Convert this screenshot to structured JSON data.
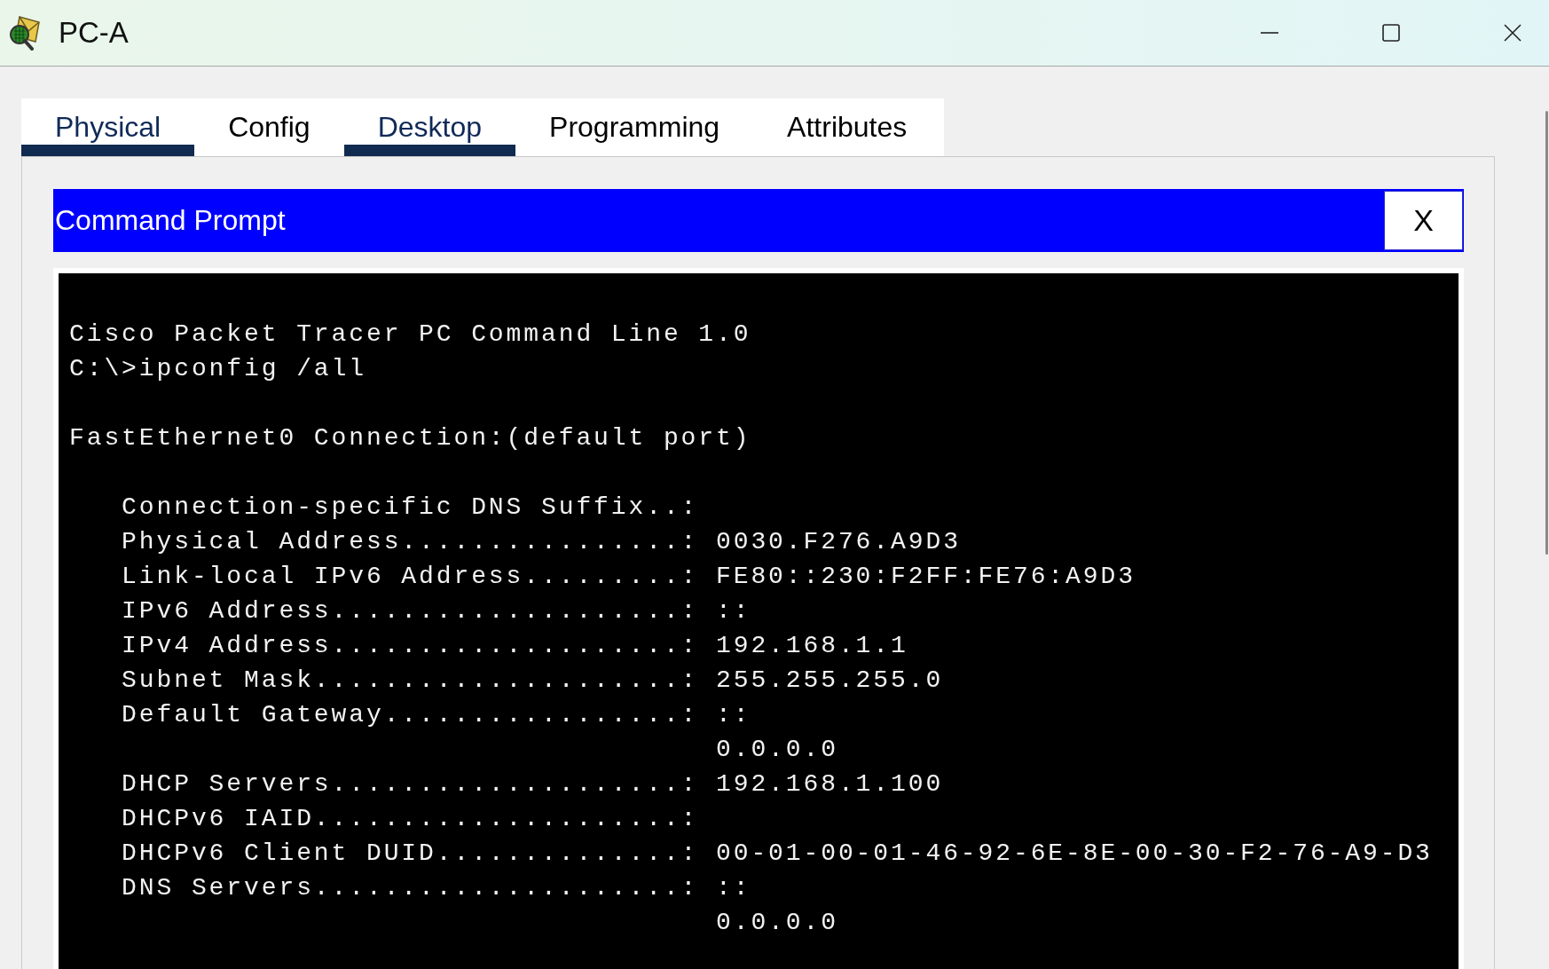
{
  "window": {
    "title": "PC-A"
  },
  "tabs": [
    {
      "label": "Physical",
      "selected": true
    },
    {
      "label": "Config",
      "selected": false
    },
    {
      "label": "Desktop",
      "selected": true
    },
    {
      "label": "Programming",
      "selected": false
    },
    {
      "label": "Attributes",
      "selected": false
    }
  ],
  "command_prompt": {
    "title": "Command Prompt",
    "close_label": "X",
    "blocks": [
      {
        "lines": [
          "Cisco Packet Tracer PC Command Line 1.0",
          "C:\\>ipconfig /all"
        ]
      },
      {
        "lines": [
          "FastEthernet0 Connection:(default port)"
        ]
      },
      {
        "lines": [
          "   Connection-specific DNS Suffix..:",
          "   Physical Address................: 0030.F276.A9D3",
          "   Link-local IPv6 Address.........: FE80::230:F2FF:FE76:A9D3",
          "   IPv6 Address....................: ::",
          "   IPv4 Address....................: 192.168.1.1",
          "   Subnet Mask.....................: 255.255.255.0",
          "   Default Gateway.................: ::",
          "                                     0.0.0.0",
          "   DHCP Servers....................: 192.168.1.100",
          "   DHCPv6 IAID.....................:",
          "   DHCPv6 Client DUID..............: 00-01-00-01-46-92-6E-8E-00-30-F2-76-A9-D3",
          "   DNS Servers.....................: ::",
          "                                     0.0.0.0"
        ]
      }
    ]
  }
}
